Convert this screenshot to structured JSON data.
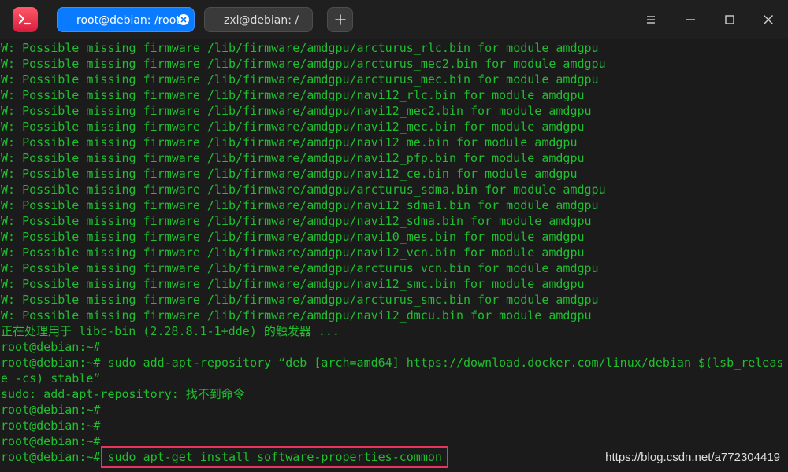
{
  "colors": {
    "accent": "#0a7aff",
    "terminal_text": "#1fbf2f",
    "highlight_border": "#e8345c",
    "background": "#1b1b1b"
  },
  "tabs": [
    {
      "label": "root@debian: /root",
      "active": true
    },
    {
      "label": "zxl@debian: /",
      "active": false
    }
  ],
  "terminal": {
    "lines": [
      "W: Possible missing firmware /lib/firmware/amdgpu/arcturus_rlc.bin for module amdgpu",
      "W: Possible missing firmware /lib/firmware/amdgpu/arcturus_mec2.bin for module amdgpu",
      "W: Possible missing firmware /lib/firmware/amdgpu/arcturus_mec.bin for module amdgpu",
      "W: Possible missing firmware /lib/firmware/amdgpu/navi12_rlc.bin for module amdgpu",
      "W: Possible missing firmware /lib/firmware/amdgpu/navi12_mec2.bin for module amdgpu",
      "W: Possible missing firmware /lib/firmware/amdgpu/navi12_mec.bin for module amdgpu",
      "W: Possible missing firmware /lib/firmware/amdgpu/navi12_me.bin for module amdgpu",
      "W: Possible missing firmware /lib/firmware/amdgpu/navi12_pfp.bin for module amdgpu",
      "W: Possible missing firmware /lib/firmware/amdgpu/navi12_ce.bin for module amdgpu",
      "W: Possible missing firmware /lib/firmware/amdgpu/arcturus_sdma.bin for module amdgpu",
      "W: Possible missing firmware /lib/firmware/amdgpu/navi12_sdma1.bin for module amdgpu",
      "W: Possible missing firmware /lib/firmware/amdgpu/navi12_sdma.bin for module amdgpu",
      "W: Possible missing firmware /lib/firmware/amdgpu/navi10_mes.bin for module amdgpu",
      "W: Possible missing firmware /lib/firmware/amdgpu/navi12_vcn.bin for module amdgpu",
      "W: Possible missing firmware /lib/firmware/amdgpu/arcturus_vcn.bin for module amdgpu",
      "W: Possible missing firmware /lib/firmware/amdgpu/navi12_smc.bin for module amdgpu",
      "W: Possible missing firmware /lib/firmware/amdgpu/arcturus_smc.bin for module amdgpu",
      "W: Possible missing firmware /lib/firmware/amdgpu/navi12_dmcu.bin for module amdgpu",
      "正在处理用于 libc-bin (2.28.8.1-1+dde) 的触发器 ...",
      "root@debian:~#",
      "root@debian:~# sudo add-apt-repository “deb [arch=amd64] https://download.docker.com/linux/debian $(lsb_releas",
      "e -cs) stable”",
      "sudo: add-apt-repository: 找不到命令",
      "root@debian:~#",
      "root@debian:~#",
      "root@debian:~#"
    ],
    "last_prompt": "root@debian:~#",
    "current_command": "sudo apt-get install software-properties-common"
  },
  "watermark": "https://blog.csdn.net/a772304419"
}
